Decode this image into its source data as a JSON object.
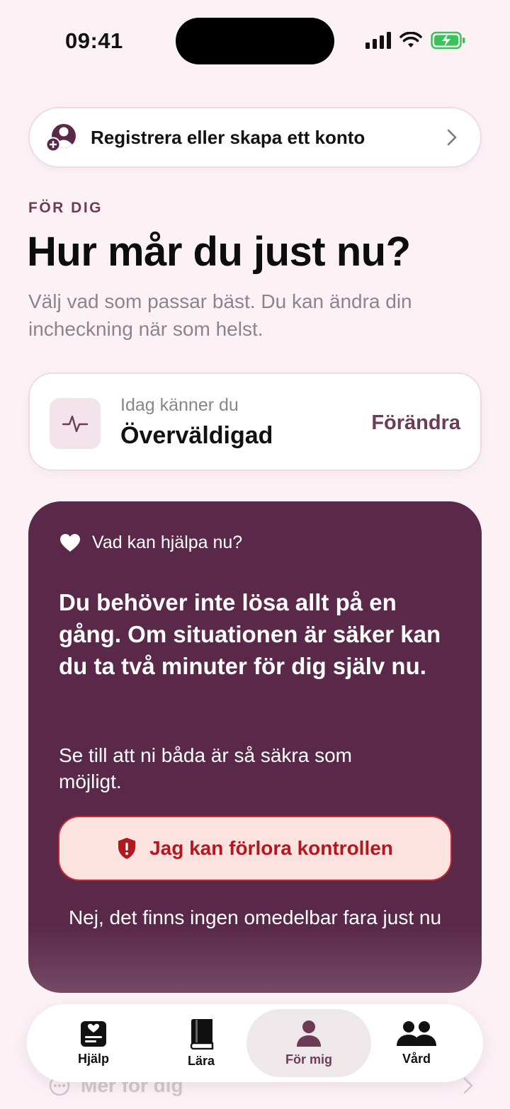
{
  "status": {
    "time": "09:41"
  },
  "register": {
    "label": "Registrera eller skapa ett konto"
  },
  "intro": {
    "eyebrow": "FÖR DIG",
    "title": "Hur mår du just nu?",
    "subtitle": "Välj vad som passar bäst. Du kan ändra din incheckning när som helst."
  },
  "mood": {
    "caption": "Idag känner du",
    "value": "Överväldigad",
    "change_label": "Förändra"
  },
  "help": {
    "heading": "Vad kan hjälpa nu?",
    "message": "Du behöver inte lösa allt på en gång. Om situationen är säker kan du ta två minuter för dig själv nu.",
    "safety_note": "Se till att ni båda är så säkra som möjligt.",
    "danger_button": "Jag kan förlora kontrollen",
    "safe_button": "Nej, det finns ingen omedelbar fara just nu"
  },
  "peek": {
    "label": "Mer för dig"
  },
  "tabs": [
    {
      "label": "Hjälp",
      "icon": "help-card-icon",
      "active": false
    },
    {
      "label": "Lära",
      "icon": "book-icon",
      "active": false
    },
    {
      "label": "För mig",
      "icon": "person-icon",
      "active": true
    },
    {
      "label": "Vård",
      "icon": "people-icon",
      "active": false
    }
  ],
  "colors": {
    "accent": "#6e3b57",
    "panel": "#5a2849",
    "danger": "#b3181f",
    "background": "#fcf2f6"
  }
}
